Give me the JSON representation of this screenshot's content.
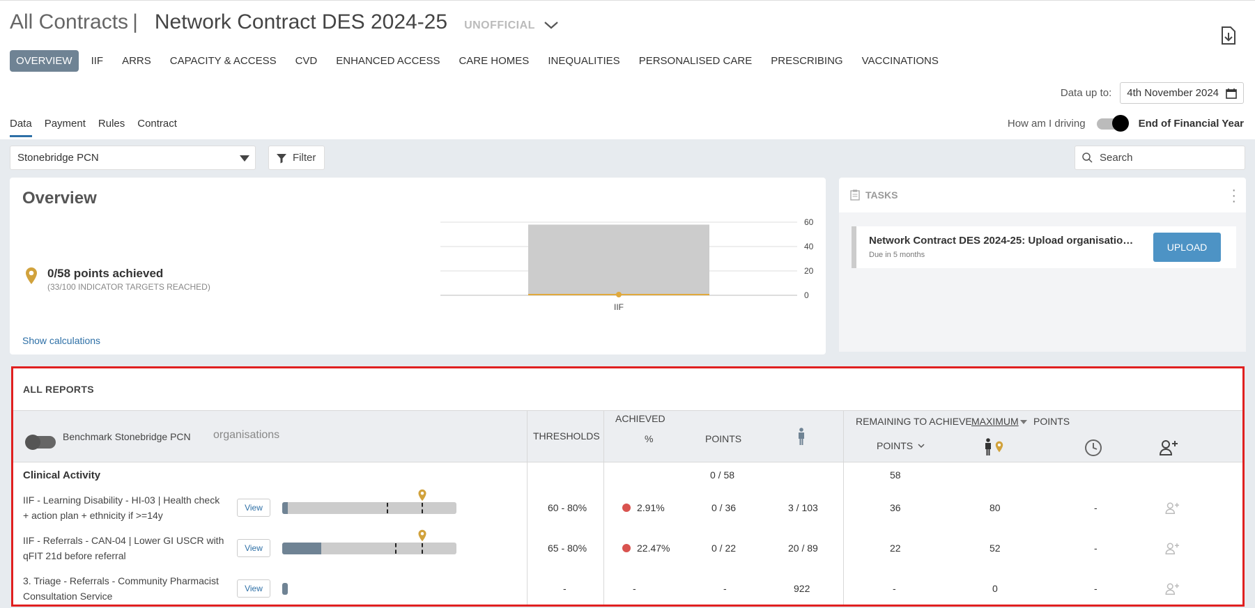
{
  "header": {
    "breadcrumb_root": "All Contracts",
    "separator": "|",
    "contract_name": "Network Contract DES 2024-25",
    "status": "UNOFFICIAL"
  },
  "nav": {
    "tabs": [
      "OVERVIEW",
      "IIF",
      "ARRS",
      "CAPACITY & ACCESS",
      "CVD",
      "ENHANCED ACCESS",
      "CARE HOMES",
      "INEQUALITIES",
      "PERSONALISED CARE",
      "PRESCRIBING",
      "VACCINATIONS"
    ]
  },
  "data_up_to": {
    "label": "Data up to:",
    "value": "4th November 2024"
  },
  "subtabs": [
    "Data",
    "Payment",
    "Rules",
    "Contract"
  ],
  "driving": {
    "label": "How am I driving",
    "option": "End of Financial Year"
  },
  "filters": {
    "pcn": "Stonebridge PCN",
    "filter_label": "Filter",
    "search_placeholder": "Search"
  },
  "overview": {
    "title": "Overview",
    "points_achieved": "0/58 points achieved",
    "targets_reached": "(33/100 INDICATOR TARGETS REACHED)",
    "show_calculations": "Show calculations"
  },
  "chart_data": {
    "type": "bar",
    "categories": [
      "IIF"
    ],
    "series": [
      {
        "values": [
          58
        ]
      },
      {
        "values": [
          0
        ]
      }
    ],
    "yticks": [
      "60",
      "40",
      "20",
      "0"
    ],
    "ylim": [
      0,
      60
    ],
    "colors": {
      "max": "#cccccc",
      "achieved": "#e0a93c"
    }
  },
  "tasks": {
    "title": "TASKS",
    "item_title": "Network Contract DES 2024-25: Upload organisational ...",
    "item_due": "Due in 5 months",
    "upload_label": "UPLOAD"
  },
  "reports": {
    "title": "ALL REPORTS",
    "benchmark_label": "Benchmark Stonebridge PCN",
    "organisations_label": "organisations",
    "col_thresholds": "THRESHOLDS",
    "col_achieved": "ACHIEVED",
    "col_pct": "%",
    "col_points": "POINTS",
    "col_remaining": "REMAINING TO ACHIEVE",
    "col_maximum": "MAXIMUM",
    "col_points2": "POINTS",
    "col_points_sort": "POINTS",
    "section": {
      "name": "Clinical Activity",
      "points": "0 / 58",
      "remaining": "58"
    },
    "rows": [
      {
        "name": "IIF - Learning Disability - HI-03 | Health check + action plan + ethnicity if >=14y",
        "view": "View",
        "thresholds": "60 - 80%",
        "pct": "2.91%",
        "points": "0 / 36",
        "patients": "3 / 103",
        "remaining_points": "36",
        "remaining_patients": "80",
        "time": "-",
        "fill": 0.03
      },
      {
        "name": "IIF - Referrals - CAN-04 | Lower GI USCR with qFIT 21d before referral",
        "view": "View",
        "thresholds": "65 - 80%",
        "pct": "22.47%",
        "points": "0 / 22",
        "patients": "20 / 89",
        "remaining_points": "22",
        "remaining_patients": "52",
        "time": "-",
        "fill": 0.2247
      },
      {
        "name": "3. Triage - Referrals - Community Pharmacist Consultation Service",
        "view": "View",
        "thresholds": "-",
        "pct": "-",
        "points": "-",
        "patients": "922",
        "remaining_points": "-",
        "remaining_patients": "0",
        "time": "-",
        "fill": 0.03
      }
    ]
  }
}
